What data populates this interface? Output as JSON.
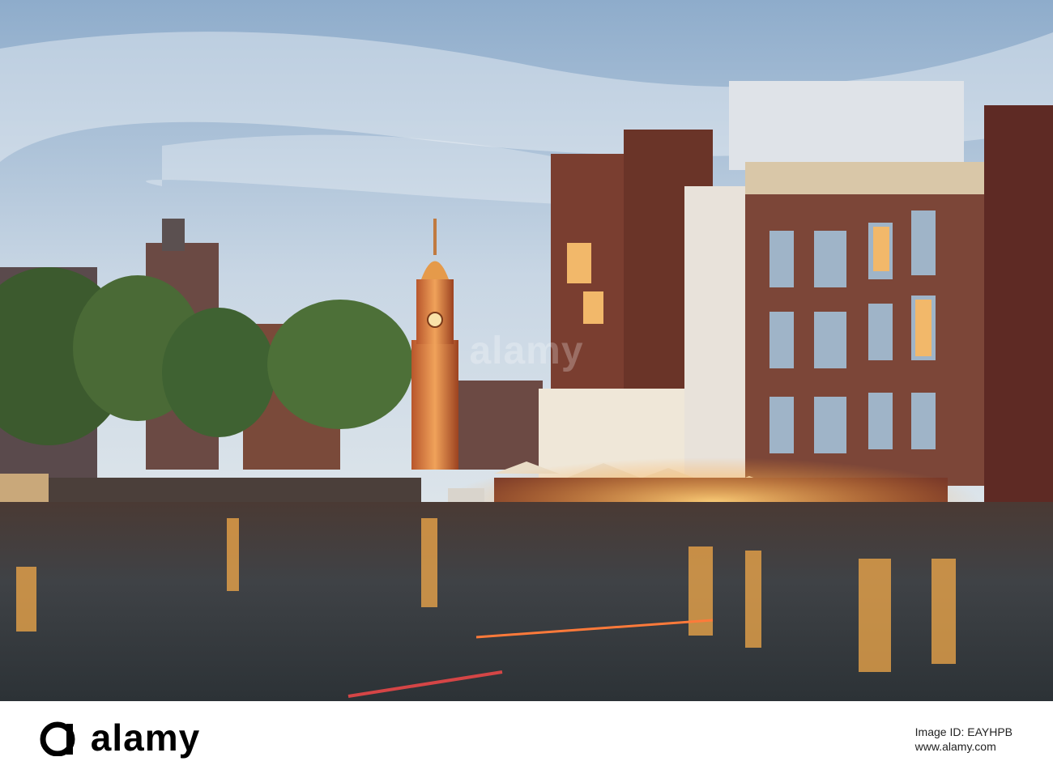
{
  "photo": {
    "subject": "Amsterdam canal at dusk with Munttoren tower and illuminated riverside buildings",
    "watermark_text": "alamy"
  },
  "footer": {
    "logo_text": "alamy",
    "image_id": "Image ID: EAYHPB",
    "site_url": "www.alamy.com"
  },
  "colors": {
    "sky_top": "#9fb8d2",
    "sky_bottom": "#d7e1ea",
    "water": "#3d3a3c",
    "light_glow": "#ffb648",
    "brick": "#6e3b30"
  }
}
